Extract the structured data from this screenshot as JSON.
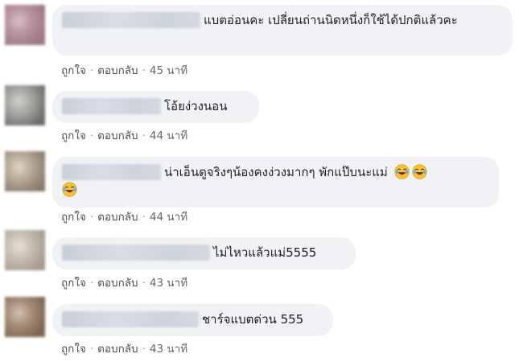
{
  "comments": [
    {
      "text": "แบตอ่อนคะ เปลี่ยนถ่านนิดหนึ่งก็ใช้ได้ปกติแล้วคะ",
      "like_label": "ถูกใจ",
      "reply_label": "ตอบกลับ",
      "separator": "·",
      "time": "45 นาที",
      "avatar_colors": [
        "#9c7784",
        "#b8949e",
        "#d5c2c8"
      ],
      "emoji_count": 0
    },
    {
      "text": "โอ้ยง่วงนอน",
      "like_label": "ถูกใจ",
      "reply_label": "ตอบกลับ",
      "separator": "·",
      "time": "44 นาที",
      "avatar_colors": [
        "#6d6e6c",
        "#a5a7a2",
        "#cfd0cb"
      ],
      "emoji_count": 0
    },
    {
      "text": "น่าเอ็นดูจริงๆน้องคงง่วงมากๆ พักแป๊บนะแม่",
      "like_label": "ถูกใจ",
      "reply_label": "ตอบกลับ",
      "separator": "·",
      "time": "44 นาที",
      "avatar_colors": [
        "#8a7b6c",
        "#b7aa98",
        "#ded6ca"
      ],
      "emoji_count": 3,
      "emoji_name": "face-with-tears-of-joy-icon"
    },
    {
      "text": "ไม่ไหวแล้วแม่5555",
      "like_label": "ถูกใจ",
      "reply_label": "ตอบกลับ",
      "separator": "·",
      "time": "43 นาที",
      "avatar_colors": [
        "#a69a8c",
        "#c8bfb2",
        "#e6e0d6"
      ],
      "emoji_count": 0
    },
    {
      "text": "ชาร์จแบตด่วน 555",
      "like_label": "ถูกใจ",
      "reply_label": "ตอบกลับ",
      "separator": "·",
      "time": "43 นาที",
      "avatar_colors": [
        "#7a6450",
        "#a68f78",
        "#d2c2b0"
      ],
      "emoji_count": 0
    }
  ]
}
